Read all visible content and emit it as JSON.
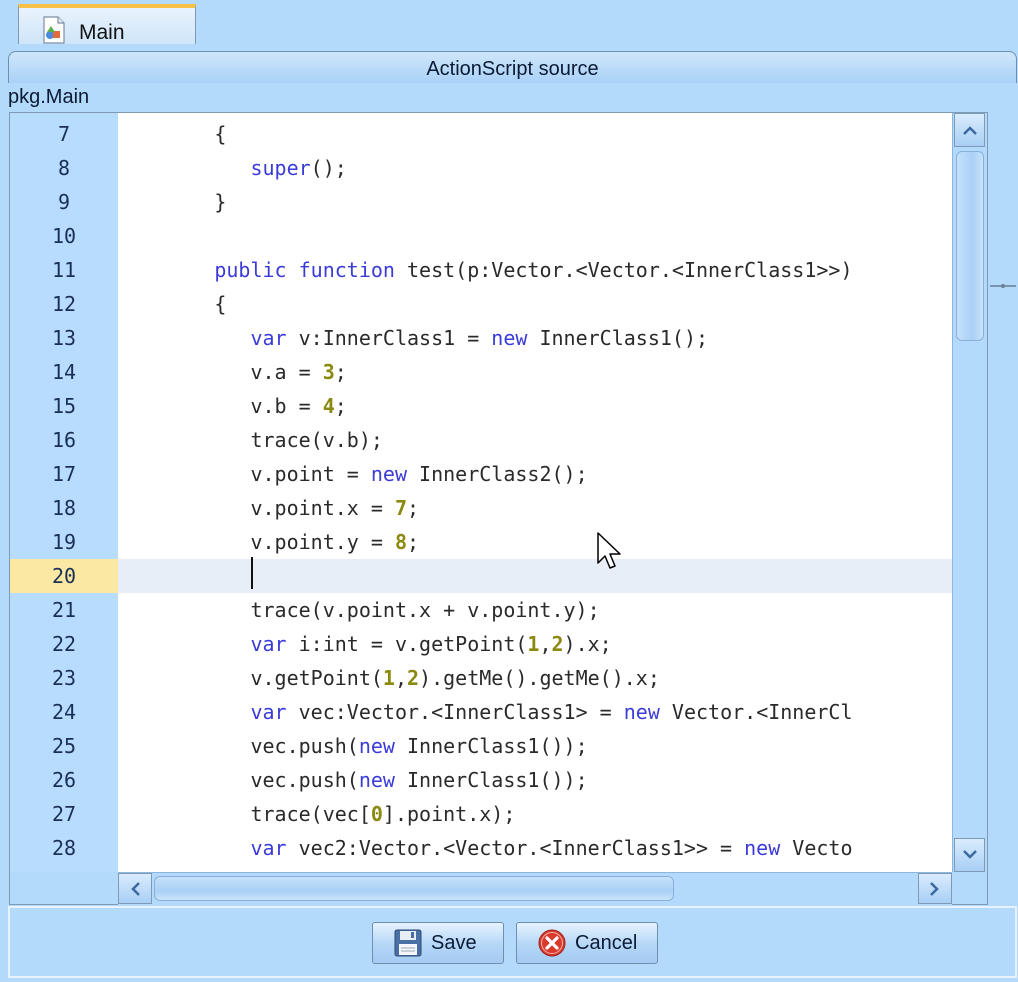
{
  "tab": {
    "label": "Main"
  },
  "panel": {
    "title": "ActionScript source"
  },
  "class_path": "pkg.Main",
  "editor": {
    "current_line": "20",
    "lines": [
      {
        "n": "7",
        "tokens": [
          [
            "p",
            "        {"
          ]
        ]
      },
      {
        "n": "8",
        "tokens": [
          [
            "p",
            "           "
          ],
          [
            "k",
            "super"
          ],
          [
            "p",
            "();"
          ]
        ]
      },
      {
        "n": "9",
        "tokens": [
          [
            "p",
            "        }"
          ]
        ]
      },
      {
        "n": "10",
        "tokens": [
          [
            "p",
            ""
          ]
        ]
      },
      {
        "n": "11",
        "tokens": [
          [
            "p",
            "        "
          ],
          [
            "k",
            "public"
          ],
          [
            "p",
            " "
          ],
          [
            "k",
            "function"
          ],
          [
            "p",
            " test(p:Vector.<Vector.<InnerClass1>>)"
          ]
        ]
      },
      {
        "n": "12",
        "tokens": [
          [
            "p",
            "        {"
          ]
        ]
      },
      {
        "n": "13",
        "tokens": [
          [
            "p",
            "           "
          ],
          [
            "k",
            "var"
          ],
          [
            "p",
            " v:InnerClass1 = "
          ],
          [
            "k",
            "new"
          ],
          [
            "p",
            " InnerClass1();"
          ]
        ]
      },
      {
        "n": "14",
        "tokens": [
          [
            "p",
            "           v.a = "
          ],
          [
            "n",
            "3"
          ],
          [
            "p",
            ";"
          ]
        ]
      },
      {
        "n": "15",
        "tokens": [
          [
            "p",
            "           v.b = "
          ],
          [
            "n",
            "4"
          ],
          [
            "p",
            ";"
          ]
        ]
      },
      {
        "n": "16",
        "tokens": [
          [
            "p",
            "           trace(v.b);"
          ]
        ]
      },
      {
        "n": "17",
        "tokens": [
          [
            "p",
            "           v.point = "
          ],
          [
            "k",
            "new"
          ],
          [
            "p",
            " InnerClass2();"
          ]
        ]
      },
      {
        "n": "18",
        "tokens": [
          [
            "p",
            "           v.point.x = "
          ],
          [
            "n",
            "7"
          ],
          [
            "p",
            ";"
          ]
        ]
      },
      {
        "n": "19",
        "tokens": [
          [
            "p",
            "           v.point.y = "
          ],
          [
            "n",
            "8"
          ],
          [
            "p",
            ";"
          ]
        ]
      },
      {
        "n": "20",
        "tokens": [
          [
            "p",
            ""
          ]
        ]
      },
      {
        "n": "21",
        "tokens": [
          [
            "p",
            "           trace(v.point.x + v.point.y);"
          ]
        ]
      },
      {
        "n": "22",
        "tokens": [
          [
            "p",
            "           "
          ],
          [
            "k",
            "var"
          ],
          [
            "p",
            " i:int = v.getPoint("
          ],
          [
            "n",
            "1"
          ],
          [
            "p",
            ","
          ],
          [
            "n",
            "2"
          ],
          [
            "p",
            ").x;"
          ]
        ]
      },
      {
        "n": "23",
        "tokens": [
          [
            "p",
            "           v.getPoint("
          ],
          [
            "n",
            "1"
          ],
          [
            "p",
            ","
          ],
          [
            "n",
            "2"
          ],
          [
            "p",
            ").getMe().getMe().x;"
          ]
        ]
      },
      {
        "n": "24",
        "tokens": [
          [
            "p",
            "           "
          ],
          [
            "k",
            "var"
          ],
          [
            "p",
            " vec:Vector.<InnerClass1> = "
          ],
          [
            "k",
            "new"
          ],
          [
            "p",
            " Vector.<InnerCl"
          ]
        ]
      },
      {
        "n": "25",
        "tokens": [
          [
            "p",
            "           vec.push("
          ],
          [
            "k",
            "new"
          ],
          [
            "p",
            " InnerClass1());"
          ]
        ]
      },
      {
        "n": "26",
        "tokens": [
          [
            "p",
            "           vec.push("
          ],
          [
            "k",
            "new"
          ],
          [
            "p",
            " InnerClass1());"
          ]
        ]
      },
      {
        "n": "27",
        "tokens": [
          [
            "p",
            "           trace(vec["
          ],
          [
            "n",
            "0"
          ],
          [
            "p",
            "].point.x);"
          ]
        ]
      },
      {
        "n": "28",
        "tokens": [
          [
            "p",
            "           "
          ],
          [
            "k",
            "var"
          ],
          [
            "p",
            " vec2:Vector.<Vector.<InnerClass1>> = "
          ],
          [
            "k",
            "new"
          ],
          [
            "p",
            " Vecto"
          ]
        ]
      }
    ]
  },
  "buttons": {
    "save": "Save",
    "cancel": "Cancel"
  },
  "colors": {
    "background": "#b3d9fb",
    "keyword": "#3b3bd8",
    "number": "#8a8a10",
    "current_line_gutter": "#fbe9a3",
    "current_line_code": "#e8eef8",
    "tab_accent": "#f7c046"
  },
  "icons": {
    "tab": "class-file-icon",
    "save": "floppy-disk-icon",
    "cancel": "red-x-circle-icon"
  }
}
